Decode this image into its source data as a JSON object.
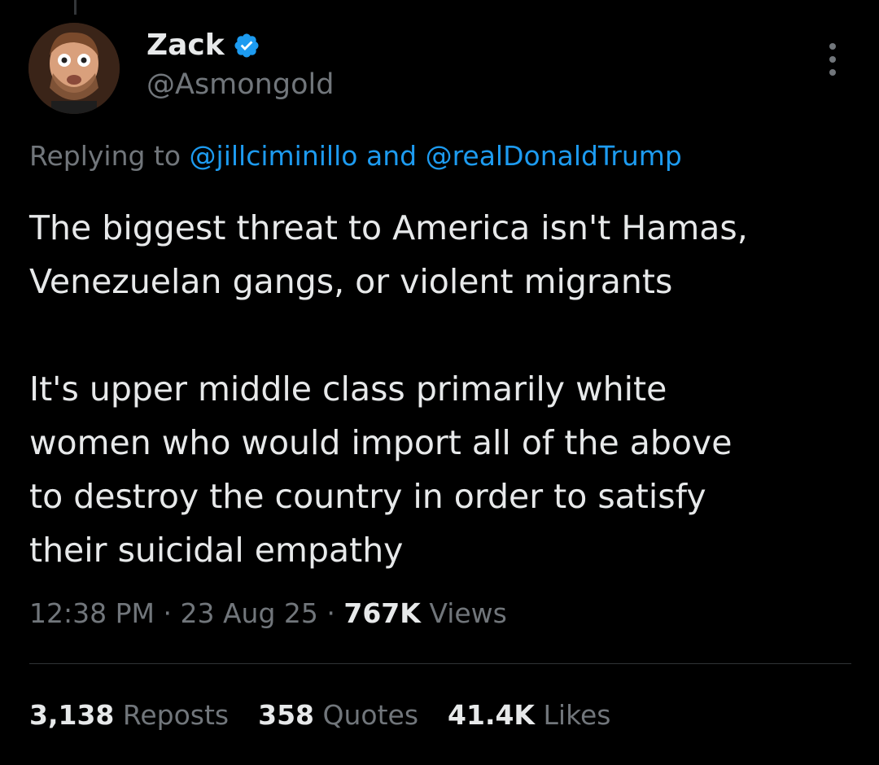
{
  "author": {
    "display_name": "Zack",
    "handle": "@Asmongold",
    "verified": true
  },
  "reply_context": {
    "prefix": "Replying to",
    "mention_1": "@jillciminillo",
    "joiner": "and",
    "mention_2": "@realDonaldTrump"
  },
  "tweet": {
    "paragraph_1": {
      "line_1": "The biggest threat to America isn't Hamas,",
      "line_2": "Venezuelan gangs, or violent migrants"
    },
    "paragraph_2": {
      "line_1": "It's upper middle class primarily white",
      "line_2": "women who would import all of the above",
      "line_3": "to destroy the country in order to satisfy",
      "line_4": "their suicidal empathy"
    }
  },
  "meta": {
    "time": "12:38 PM",
    "separator": "·",
    "date": "23 Aug 25",
    "views_count": "767K",
    "views_label": "Views"
  },
  "stats": {
    "reposts": {
      "count": "3,138",
      "label": "Reposts"
    },
    "quotes": {
      "count": "358",
      "label": "Quotes"
    },
    "likes": {
      "count": "41.4K",
      "label": "Likes"
    }
  },
  "icons": {
    "verified": "verified-badge-icon",
    "more": "more-options-icon"
  },
  "colors": {
    "background": "#000000",
    "text_primary": "#e7e9ea",
    "text_secondary": "#71767b",
    "link": "#1d9bf0",
    "verified": "#1d9bf0"
  }
}
